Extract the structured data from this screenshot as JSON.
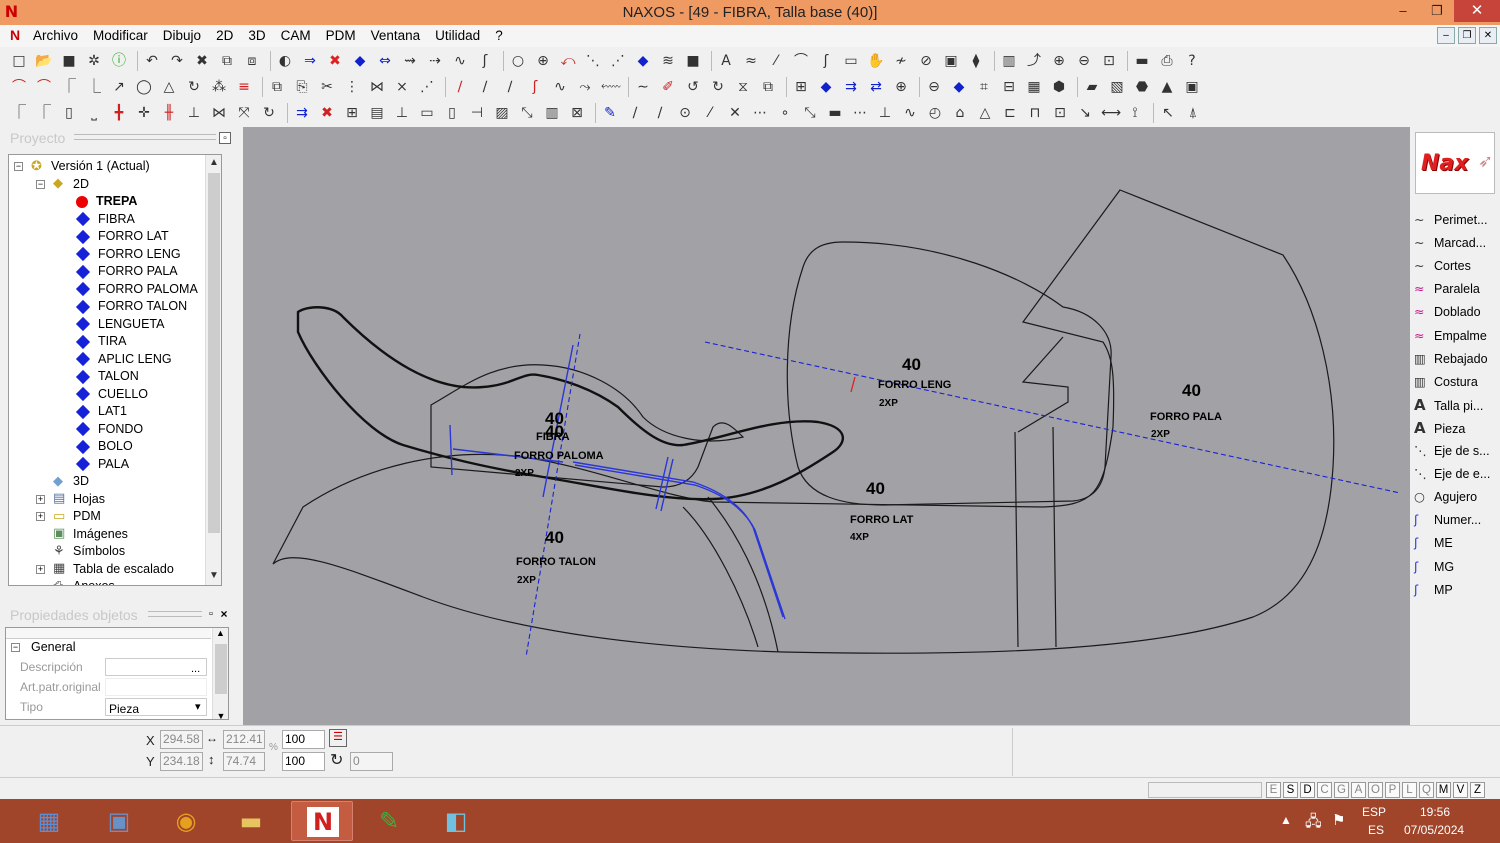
{
  "window": {
    "title": "NAXOS - [49 - FIBRA, Talla base (40)]",
    "minimize": "–",
    "maximize": "❐",
    "close": "✕"
  },
  "menu": [
    "Archivo",
    "Modificar",
    "Dibujo",
    "2D",
    "3D",
    "CAM",
    "PDM",
    "Ventana",
    "Utilidad",
    "?"
  ],
  "mdi_controls": [
    "–",
    "❐",
    "✕"
  ],
  "project_panel": {
    "title": "Proyecto",
    "tree": [
      {
        "label": "Versión 1 (Actual)",
        "kind": "version",
        "expander": "−"
      },
      {
        "label": "2D",
        "kind": "folder2d",
        "expander": "−"
      },
      {
        "label": "TREPA",
        "kind": "red",
        "bold": true
      },
      {
        "label": "FIBRA",
        "kind": "piece"
      },
      {
        "label": "FORRO LAT",
        "kind": "piece"
      },
      {
        "label": "FORRO LENG",
        "kind": "piece"
      },
      {
        "label": "FORRO PALA",
        "kind": "piece"
      },
      {
        "label": "FORRO PALOMA",
        "kind": "piece"
      },
      {
        "label": "FORRO TALON",
        "kind": "piece"
      },
      {
        "label": "LENGUETA",
        "kind": "piece"
      },
      {
        "label": "TIRA",
        "kind": "piece"
      },
      {
        "label": "APLIC LENG",
        "kind": "piece"
      },
      {
        "label": "TALON",
        "kind": "piece"
      },
      {
        "label": "CUELLO",
        "kind": "piece"
      },
      {
        "label": "LAT1",
        "kind": "piece"
      },
      {
        "label": "FONDO",
        "kind": "piece"
      },
      {
        "label": "BOLO",
        "kind": "piece"
      },
      {
        "label": "PALA",
        "kind": "piece"
      },
      {
        "label": "3D",
        "kind": "folder3d"
      },
      {
        "label": "Hojas",
        "kind": "sheets",
        "expander": "+"
      },
      {
        "label": "PDM",
        "kind": "pdm",
        "expander": "+"
      },
      {
        "label": "Imágenes",
        "kind": "images"
      },
      {
        "label": "Símbolos",
        "kind": "symbols"
      },
      {
        "label": "Tabla de escalado",
        "kind": "table",
        "expander": "+"
      },
      {
        "label": "Anexos",
        "kind": "annex"
      }
    ]
  },
  "properties_panel": {
    "title": "Propiedades objetos",
    "group": "General",
    "rows": [
      {
        "key": "Descripción",
        "value": "",
        "button": "..."
      },
      {
        "key": "Art.patr.original",
        "value": ""
      },
      {
        "key": "Tipo",
        "value": "Pieza",
        "dropdown": "▾"
      }
    ]
  },
  "canvas_labels": [
    {
      "size": "40",
      "name": "FIBRA",
      "qty": ""
    },
    {
      "size": "40",
      "name": "FORRO PALOMA",
      "qty": "2XP"
    },
    {
      "size": "40",
      "name": "FORRO LENG",
      "qty": "2XP"
    },
    {
      "size": "40",
      "name": "FORRO PALA",
      "qty": "2XP"
    },
    {
      "size": "40",
      "name": "FORRO LAT",
      "qty": "4XP"
    },
    {
      "size": "40",
      "name": "FORRO TALON",
      "qty": "2XP"
    }
  ],
  "right_tools": [
    {
      "label": "Perimet...",
      "icon": "perimeter-icon"
    },
    {
      "label": "Marcad...",
      "icon": "marker-icon"
    },
    {
      "label": "Cortes",
      "icon": "cut-icon"
    },
    {
      "label": "Paralela",
      "icon": "parallel-icon"
    },
    {
      "label": "Doblado",
      "icon": "fold-icon"
    },
    {
      "label": "Empalme",
      "icon": "splice-icon"
    },
    {
      "label": "Rebajado",
      "icon": "skive-icon"
    },
    {
      "label": "Costura",
      "icon": "seam-icon"
    },
    {
      "label": "Talla pi...",
      "icon": "size-text-icon"
    },
    {
      "label": "Pieza",
      "icon": "piece-text-icon"
    },
    {
      "label": "Eje de s...",
      "icon": "axis-s-icon"
    },
    {
      "label": "Eje de e...",
      "icon": "axis-e-icon"
    },
    {
      "label": "Agujero",
      "icon": "hole-icon"
    },
    {
      "label": "Numer...",
      "icon": "number-icon"
    },
    {
      "label": "ME",
      "icon": "me-icon"
    },
    {
      "label": "MG",
      "icon": "mg-icon"
    },
    {
      "label": "MP",
      "icon": "mp-icon"
    }
  ],
  "logo_text": "Nax",
  "coords": {
    "x_label": "X",
    "y_label": "Y",
    "x": "294.58",
    "y": "234.18",
    "width": "212.41",
    "height": "74.74",
    "scale_x": "100",
    "scale_y": "100",
    "percent": "%",
    "rotation": "0"
  },
  "status_keys": [
    {
      "k": "E",
      "on": false
    },
    {
      "k": "S",
      "on": true
    },
    {
      "k": "D",
      "on": true
    },
    {
      "k": "C",
      "on": false
    },
    {
      "k": "G",
      "on": false
    },
    {
      "k": "A",
      "on": false
    },
    {
      "k": "O",
      "on": false
    },
    {
      "k": "P",
      "on": false
    },
    {
      "k": "L",
      "on": false
    },
    {
      "k": "Q",
      "on": false
    },
    {
      "k": "M",
      "on": true
    },
    {
      "k": "V",
      "on": true
    },
    {
      "k": "Z",
      "on": true
    }
  ],
  "taskbar": {
    "lang_top": "ESP",
    "lang_bottom": "ES",
    "time": "19:56",
    "date": "07/05/2024",
    "tray_up": "▲",
    "apps": [
      {
        "name": "calculator-app",
        "glyph": "▦",
        "color": "#5a8ed8"
      },
      {
        "name": "explorer-task-app",
        "glyph": "▣",
        "color": "#6a90c8"
      },
      {
        "name": "chrome-app",
        "glyph": "◉",
        "color": "#e6a020"
      },
      {
        "name": "file-explorer-app",
        "glyph": "▬",
        "color": "#e8c460"
      },
      {
        "name": "naxos-app",
        "glyph": "N",
        "color": "#d02020"
      },
      {
        "name": "green-leaf-app",
        "glyph": "✎",
        "color": "#40b040"
      },
      {
        "name": "notes-app",
        "glyph": "◧",
        "color": "#70c0e0"
      }
    ]
  }
}
